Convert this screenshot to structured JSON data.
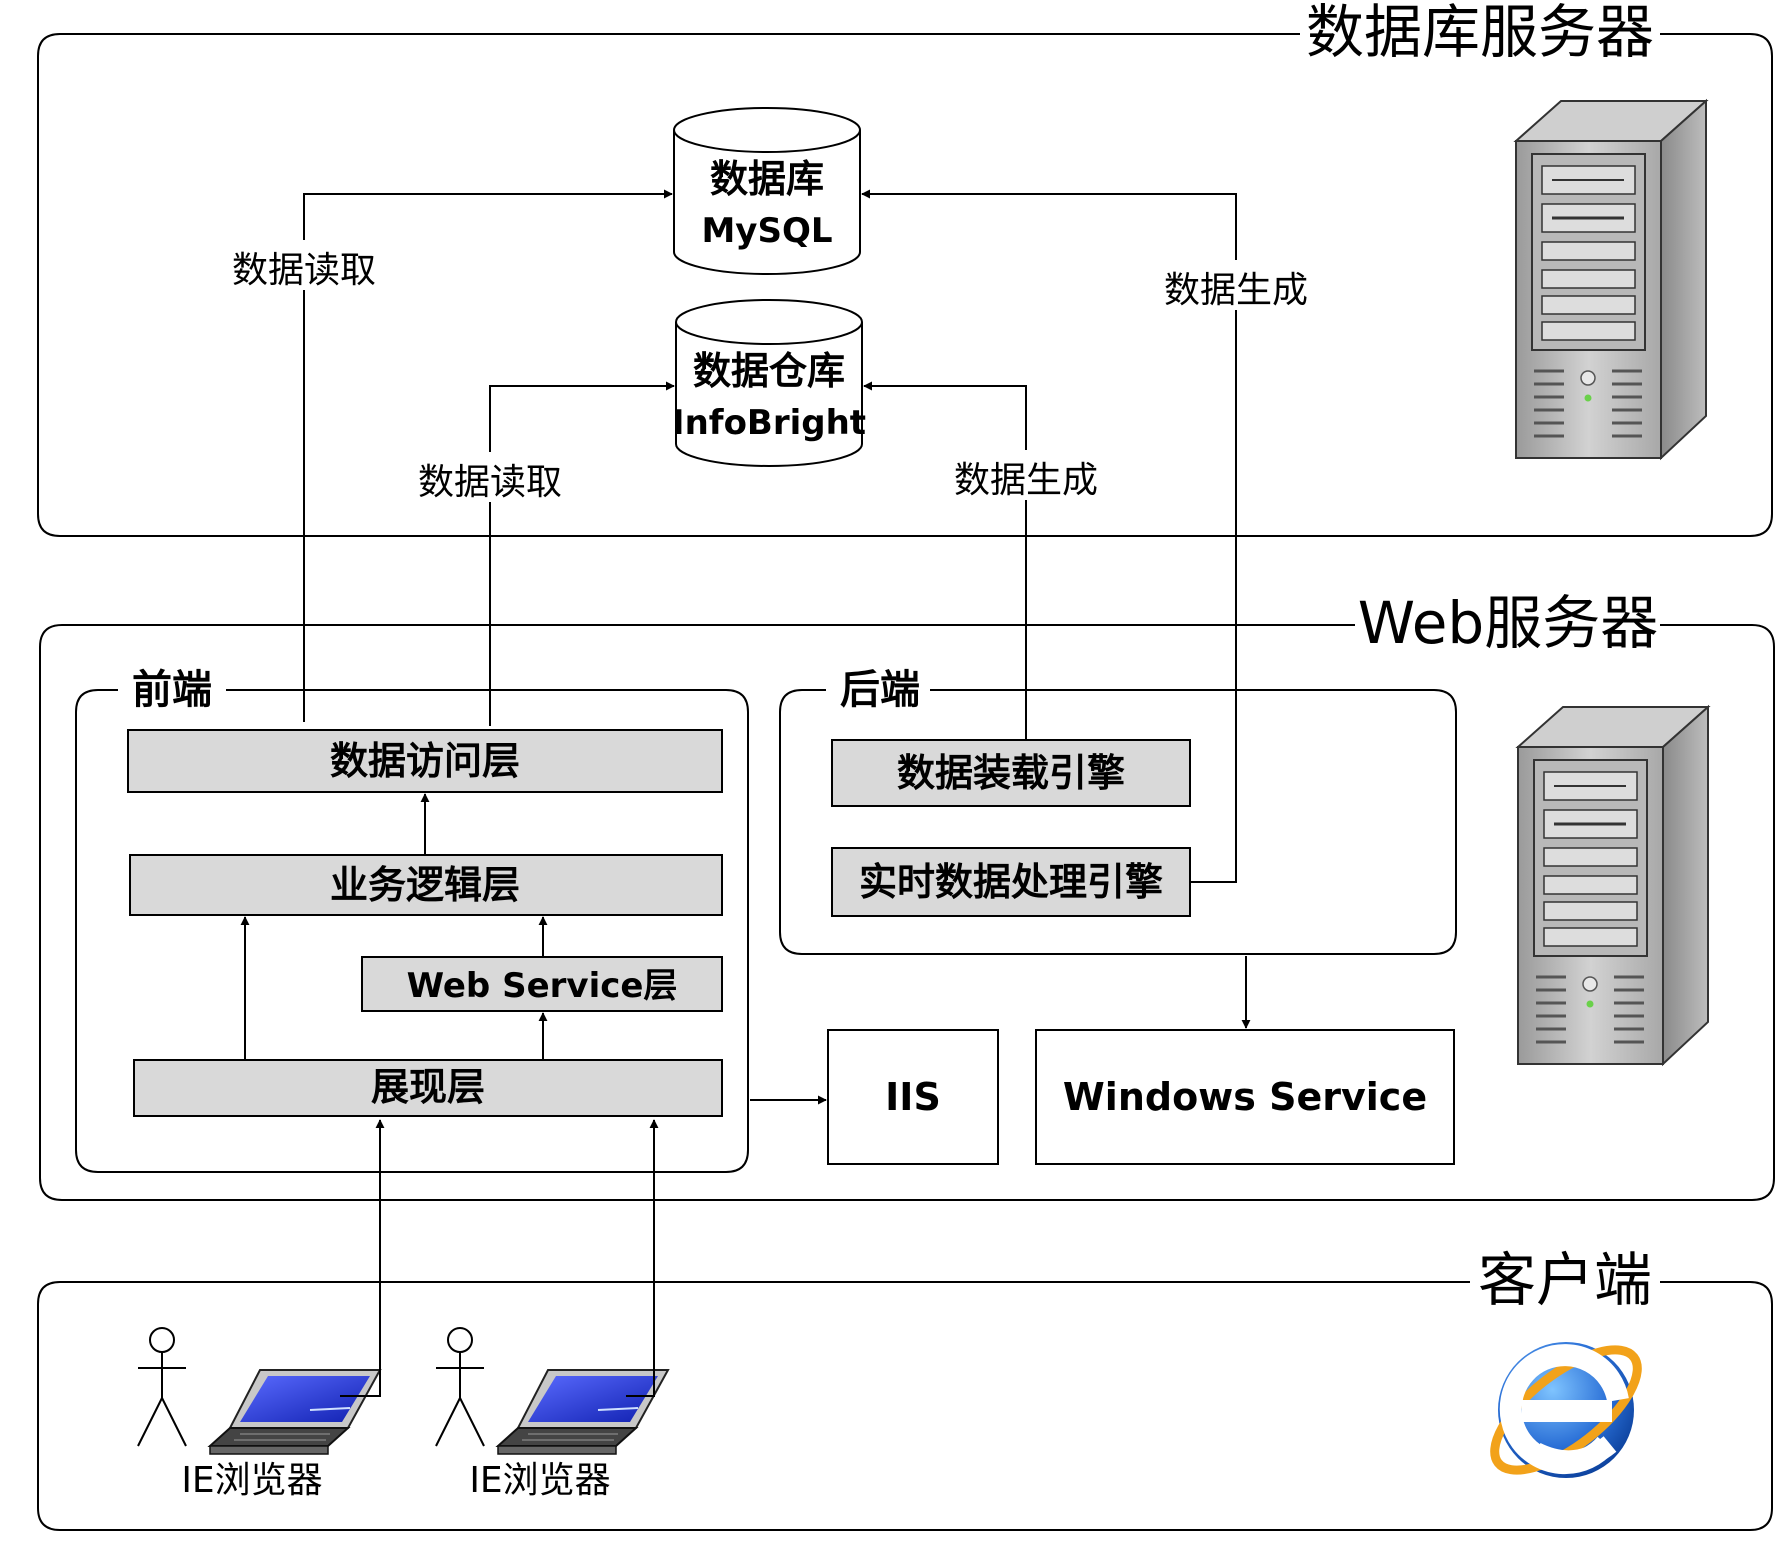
{
  "zones": {
    "db_server": {
      "title": "数据库服务器"
    },
    "web_server": {
      "title": "Web服务器"
    },
    "client": {
      "title": "客户端"
    }
  },
  "frontend": {
    "title": "前端",
    "data_access_layer": "数据访问层",
    "business_logic_layer": "业务逻辑层",
    "web_service_layer": "Web Service层",
    "presentation_layer": "展现层"
  },
  "backend": {
    "title": "后端",
    "data_loading_engine": "数据装载引擎",
    "realtime_engine": "实时数据处理引擎"
  },
  "services": {
    "iis": "IIS",
    "windows_service": "Windows Service"
  },
  "databases": {
    "mysql": {
      "line1": "数据库",
      "line2": "MySQL"
    },
    "warehouse": {
      "line1": "数据仓库",
      "line2": "InfoBright"
    }
  },
  "edge_labels": {
    "read_mysql": "数据读取",
    "read_warehouse": "数据读取",
    "generate_mysql": "数据生成",
    "generate_warehouse": "数据生成"
  },
  "clients": [
    {
      "label": "IE浏览器"
    },
    {
      "label": "IE浏览器"
    }
  ],
  "icons": {
    "server": "server-tower-icon",
    "user": "user-stick-figure-icon",
    "laptop": "laptop-icon",
    "browser": "internet-explorer-icon"
  },
  "colors": {
    "layer_fill": "#d9d9d9",
    "laptop_screen": "#2233dd",
    "ie_blue": "#2a6fd6",
    "ie_orange": "#f2a21a"
  }
}
